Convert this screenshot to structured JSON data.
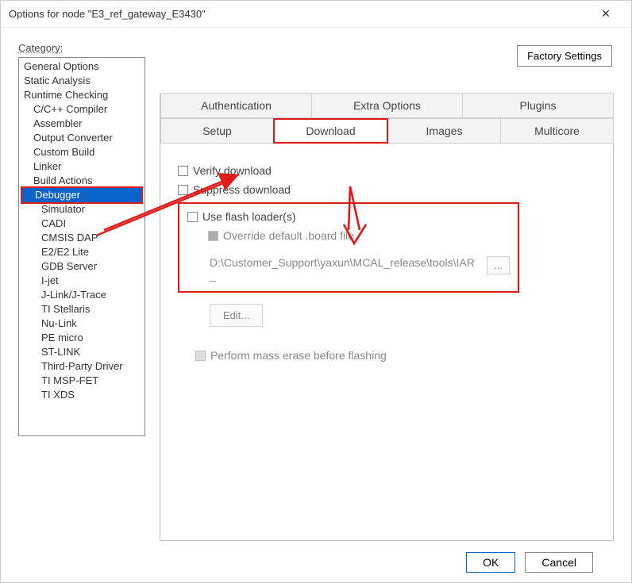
{
  "window": {
    "title": "Options for node \"E3_ref_gateway_E3430\""
  },
  "factory_settings_label": "Factory Settings",
  "category_label": "Category:",
  "category": {
    "items": [
      {
        "label": "General Options",
        "indent": false,
        "selected": false
      },
      {
        "label": "Static Analysis",
        "indent": false,
        "selected": false
      },
      {
        "label": "Runtime Checking",
        "indent": false,
        "selected": false
      },
      {
        "label": "C/C++ Compiler",
        "indent": true,
        "selected": false
      },
      {
        "label": "Assembler",
        "indent": true,
        "selected": false
      },
      {
        "label": "Output Converter",
        "indent": true,
        "selected": false
      },
      {
        "label": "Custom Build",
        "indent": true,
        "selected": false
      },
      {
        "label": "Linker",
        "indent": true,
        "selected": false
      },
      {
        "label": "Build Actions",
        "indent": true,
        "selected": false
      },
      {
        "label": "Debugger",
        "indent": true,
        "selected": true
      },
      {
        "label": "Simulator",
        "indent": true,
        "selected": false,
        "extraIndent": true
      },
      {
        "label": "CADI",
        "indent": true,
        "selected": false,
        "extraIndent": true
      },
      {
        "label": "CMSIS DAP",
        "indent": true,
        "selected": false,
        "extraIndent": true
      },
      {
        "label": "E2/E2 Lite",
        "indent": true,
        "selected": false,
        "extraIndent": true
      },
      {
        "label": "GDB Server",
        "indent": true,
        "selected": false,
        "extraIndent": true
      },
      {
        "label": "I-jet",
        "indent": true,
        "selected": false,
        "extraIndent": true
      },
      {
        "label": "J-Link/J-Trace",
        "indent": true,
        "selected": false,
        "extraIndent": true
      },
      {
        "label": "TI Stellaris",
        "indent": true,
        "selected": false,
        "extraIndent": true
      },
      {
        "label": "Nu-Link",
        "indent": true,
        "selected": false,
        "extraIndent": true
      },
      {
        "label": "PE micro",
        "indent": true,
        "selected": false,
        "extraIndent": true
      },
      {
        "label": "ST-LINK",
        "indent": true,
        "selected": false,
        "extraIndent": true
      },
      {
        "label": "Third-Party Driver",
        "indent": true,
        "selected": false,
        "extraIndent": true
      },
      {
        "label": "TI MSP-FET",
        "indent": true,
        "selected": false,
        "extraIndent": true
      },
      {
        "label": "TI XDS",
        "indent": true,
        "selected": false,
        "extraIndent": true
      }
    ]
  },
  "tabs_row1": [
    {
      "label": "Authentication",
      "active": false
    },
    {
      "label": "Extra Options",
      "active": false
    },
    {
      "label": "Plugins",
      "active": false
    }
  ],
  "tabs_row2": [
    {
      "label": "Setup",
      "active": false,
      "mark": false
    },
    {
      "label": "Download",
      "active": true,
      "mark": true
    },
    {
      "label": "Images",
      "active": false,
      "mark": false
    },
    {
      "label": "Multicore",
      "active": false,
      "mark": false
    }
  ],
  "download": {
    "verify_label": "Verify download",
    "suppress_label": "Suppress download",
    "flash": {
      "use_label": "Use flash loader(s)",
      "override_label": "Override default .board file",
      "path_value": "D:\\Customer_Support\\yaxun\\MCAL_release\\tools\\IAR_",
      "browse_label": "...",
      "edit_label": "Edit..."
    },
    "mass_erase_label": "Perform mass erase before flashing"
  },
  "footer": {
    "ok": "OK",
    "cancel": "Cancel"
  },
  "annotation_color": "#e01919"
}
